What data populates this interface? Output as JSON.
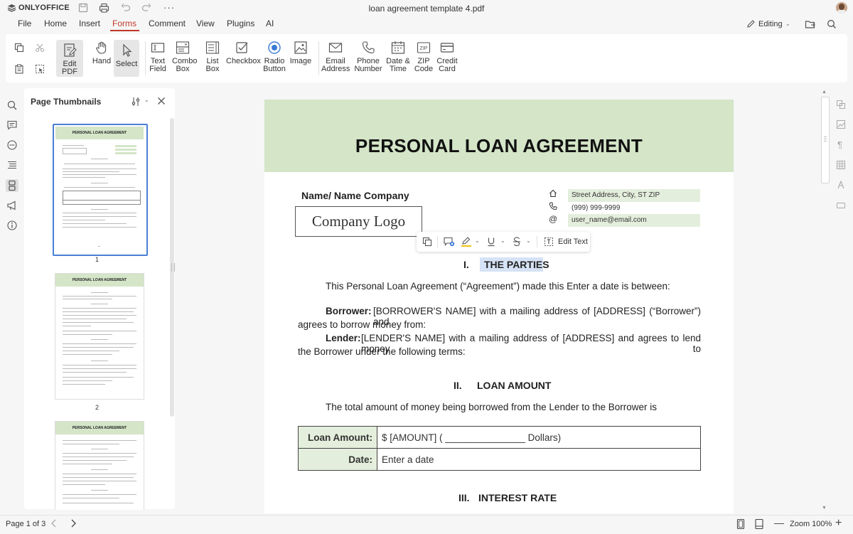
{
  "app": {
    "name": "ONLYOFFICE",
    "doc_title": "loan agreement template 4.pdf",
    "mode": "Editing"
  },
  "menu": [
    "File",
    "Home",
    "Insert",
    "Forms",
    "Comment",
    "View",
    "Plugins",
    "AI"
  ],
  "ribbon": {
    "edit_pdf": "Edit PDF",
    "hand": "Hand",
    "select": "Select",
    "text_field": "Text Field",
    "combo_box": "Combo Box",
    "list_box": "List Box",
    "checkbox": "Checkbox",
    "radio_button": "Radio Button",
    "image": "Image",
    "email_address": "Email Address",
    "phone_number": "Phone Number",
    "date_time": "Date & Time",
    "zip_code": "ZIP Code",
    "credit_card": "Credit Card"
  },
  "thumbnails": {
    "title": "Page Thumbnails",
    "pages": [
      "1",
      "2",
      "3"
    ],
    "page_header": "PERSONAL LOAN AGREEMENT"
  },
  "doc": {
    "title": "PERSONAL LOAN AGREEMENT",
    "name_company": "Name/ Name Company",
    "company_logo": "Company Logo",
    "address": "Street Address, City, ST  ZIP",
    "phone": "(999) 999-9999",
    "email": "user_name@email.com",
    "sec1_num": "I.",
    "sec1_title": "THE PARTIES",
    "intro": "This Personal Loan Agreement (“Agreement”) made this Enter a date is between:",
    "borrower_label": "Borrower:",
    "borrower_text_1": "[BORROWER'S NAME] with a mailing address of [ADDRESS] (“Borrower”) and",
    "borrower_text_2": "agrees to borrow money from:",
    "lender_label": "Lender:",
    "lender_text_1": "[LENDER'S NAME] with a mailing address of [ADDRESS] and agrees to lend money to",
    "lender_text_2": "the Borrower under the following terms:",
    "sec2_num": "II.",
    "sec2_title": "LOAN AMOUNT",
    "loan_intro": "The total amount of money being borrowed from the Lender to the Borrower is",
    "loan_amount_label": "Loan Amount:",
    "loan_amount_value": "$ [AMOUNT] ( _______________ Dollars)",
    "date_label": "Date:",
    "date_value": "Enter a date",
    "sec3_num": "III.",
    "sec3_title": "INTEREST RATE"
  },
  "floatbar": {
    "edit_text": "Edit Text"
  },
  "status": {
    "page": "Page 1 of 3",
    "zoom": "Zoom 100%"
  }
}
